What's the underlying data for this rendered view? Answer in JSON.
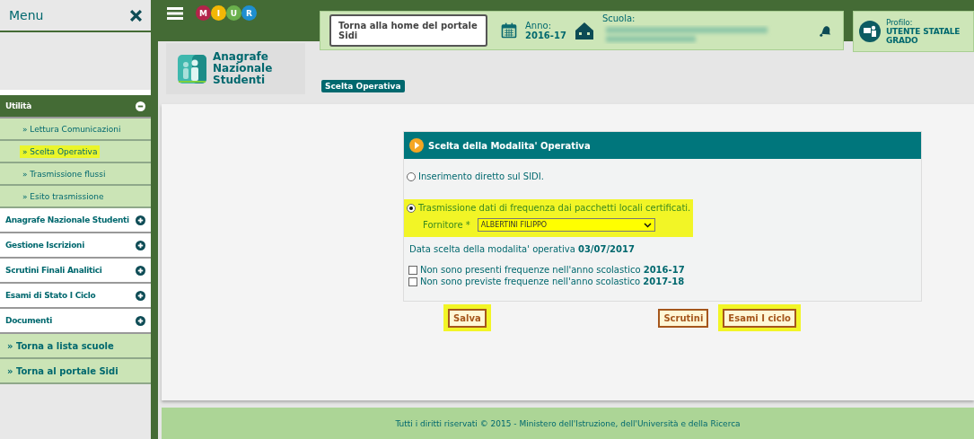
{
  "sidebar": {
    "title": "Menu",
    "sections": [
      {
        "label": "Utilità",
        "expanded": true,
        "items": [
          {
            "label": "» Lettura Comunicazioni",
            "highlighted": false
          },
          {
            "label": "» Scelta Operativa",
            "highlighted": true
          },
          {
            "label": "» Trasmissione flussi",
            "highlighted": false
          },
          {
            "label": "» Esito trasmissione",
            "highlighted": false
          }
        ]
      },
      {
        "label": "Anagrafe Nazionale Studenti",
        "expanded": false
      },
      {
        "label": "Gestione Iscrizioni",
        "expanded": false
      },
      {
        "label": "Scrutini Finali Analitici",
        "expanded": false
      },
      {
        "label": "Esami di Stato I Ciclo",
        "expanded": false
      },
      {
        "label": "Documenti",
        "expanded": false
      }
    ],
    "links": [
      "» Torna a lista scuole",
      "» Torna al portale Sidi"
    ]
  },
  "logo": {
    "letters": [
      {
        "text": "M",
        "color": "#b3244a"
      },
      {
        "text": "I",
        "color": "#f2b705"
      },
      {
        "text": "U",
        "color": "#6ab04c"
      },
      {
        "text": "R",
        "color": "#1f8fd1"
      }
    ]
  },
  "header": {
    "home_button": "Torna alla home del portale Sidi",
    "anno_label": "Anno:",
    "anno_value": "2016-17",
    "scuola_label": "Scuola:",
    "profile_label": "Profilo:",
    "profile_value": "UTENTE STATALE\nGRADO"
  },
  "app_title": "Anagrafe\nNazionale\nStudenti",
  "breadcrumb": "Scelta Operativa",
  "form": {
    "title": "Scelta della Modalita' Operativa",
    "options": [
      {
        "label": "Inserimento diretto sul SIDI.",
        "selected": false,
        "highlighted": false
      },
      {
        "label": "Trasmissione dati di frequenza dai pacchetti locali certificati.",
        "selected": true,
        "highlighted": true,
        "field_label": "Fornitore *",
        "field_value": "ALBERTINI FILIPPO"
      }
    ],
    "date_line": "Data scelta della modalita' operativa **03/07/2017**",
    "checks": [
      {
        "label": "Non sono presenti frequenze nell'anno scolastico **2016-17**",
        "checked": false
      },
      {
        "label": "Non sono previste frequenze nell'anno scolastico **2017-18**",
        "checked": false
      }
    ],
    "buttons_left": [
      {
        "label": "Salva",
        "highlighted": true
      }
    ],
    "buttons_right": [
      {
        "label": "Scrutini",
        "highlighted": false
      },
      {
        "label": "Esami I ciclo",
        "highlighted": true
      }
    ]
  },
  "footer": "Tutti i diritti riservati © 2015 -  Ministero dell'Istruzione, dell'Università e della Ricerca"
}
